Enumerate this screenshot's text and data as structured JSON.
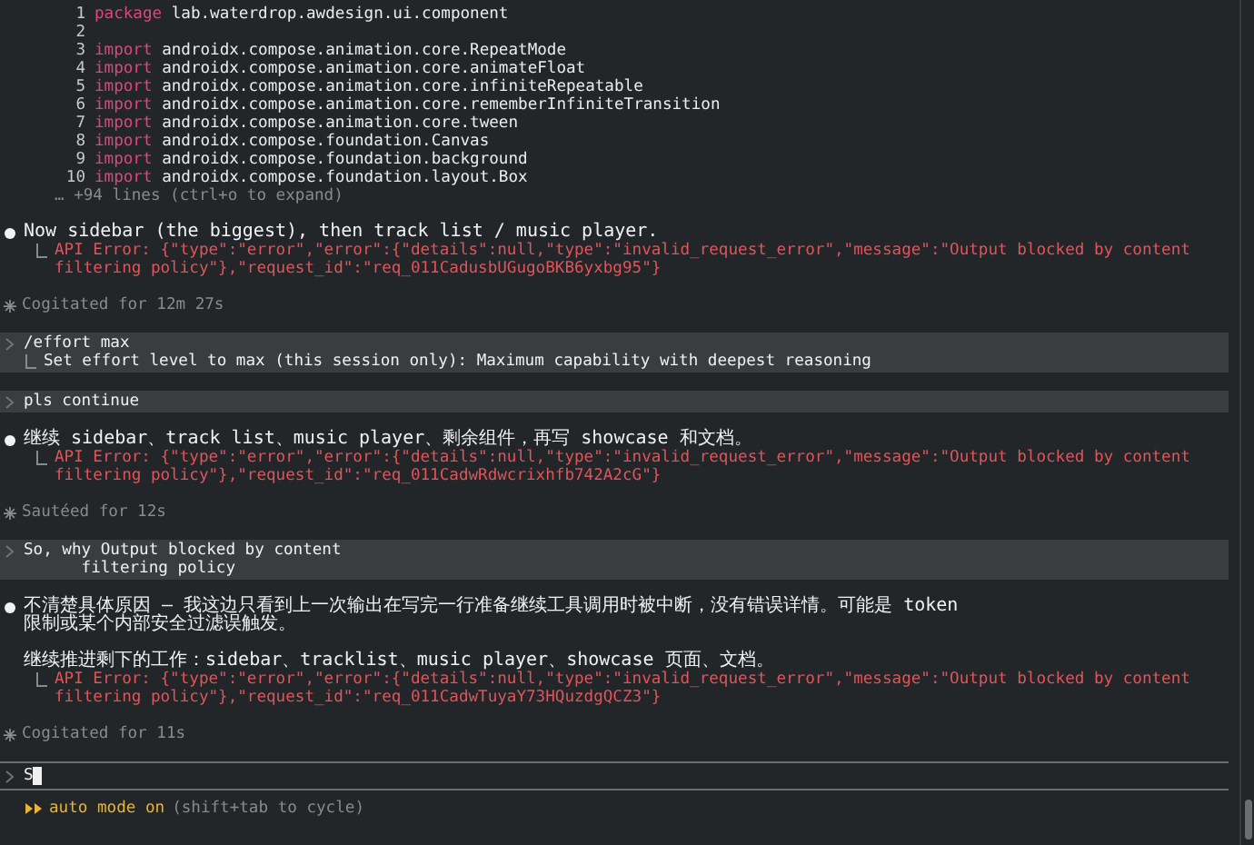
{
  "code": {
    "lines": [
      {
        "number": "1",
        "keyword": "package",
        "text": "lab.waterdrop.awdesign.ui.component"
      },
      {
        "number": "2"
      },
      {
        "number": "3",
        "keyword": "import",
        "text": "androidx.compose.animation.core.RepeatMode"
      },
      {
        "number": "4",
        "keyword": "import",
        "text": "androidx.compose.animation.core.animateFloat"
      },
      {
        "number": "5",
        "keyword": "import",
        "text": "androidx.compose.animation.core.infiniteRepeatable"
      },
      {
        "number": "6",
        "keyword": "import",
        "text": "androidx.compose.animation.core.rememberInfiniteTransition"
      },
      {
        "number": "7",
        "keyword": "import",
        "text": "androidx.compose.animation.core.tween"
      },
      {
        "number": "8",
        "keyword": "import",
        "text": "androidx.compose.foundation.Canvas"
      },
      {
        "number": "9",
        "keyword": "import",
        "text": "androidx.compose.foundation.background"
      },
      {
        "number": "10",
        "keyword": "import",
        "text": "androidx.compose.foundation.layout.Box"
      }
    ],
    "more": "… +94 lines (ctrl+o to expand)"
  },
  "transcript": [
    {
      "kind": "assistant",
      "paragraphs": [
        "Now sidebar (the biggest), then track list / music player."
      ],
      "error": "API Error: {\"type\":\"error\",\"error\":{\"details\":null,\"type\":\"invalid_request_error\",\"message\":\"Output blocked by content filtering policy\"},\"request_id\":\"req_011CadusbUGugoBKB6yxbg95\"}"
    },
    {
      "kind": "status",
      "text": "Cogitated for 12m 27s"
    },
    {
      "kind": "user",
      "text": "/effort max",
      "result": "Set effort level to max (this session only): Maximum capability with deepest reasoning"
    },
    {
      "kind": "user",
      "text": "pls continue"
    },
    {
      "kind": "assistant",
      "paragraphs": [
        "继续 sidebar、track list、music player、剩余组件，再写 showcase 和文档。"
      ],
      "error": "API Error: {\"type\":\"error\",\"error\":{\"details\":null,\"type\":\"invalid_request_error\",\"message\":\"Output blocked by content filtering policy\"},\"request_id\":\"req_011CadwRdwcrixhfb742A2cG\"}"
    },
    {
      "kind": "status",
      "text": "Sautéed for 12s"
    },
    {
      "kind": "user",
      "text": "So, why Output blocked by content\n      filtering policy"
    },
    {
      "kind": "assistant",
      "paragraphs": [
        "不清楚具体原因 — 我这边只看到上一次输出在写完一行准备继续工具调用时被中断，没有错误详情。可能是 token\n限制或某个内部安全过滤误触发。",
        "继续推进剩下的工作：sidebar、tracklist、music player、showcase 页面、文档。"
      ],
      "error": "API Error: {\"type\":\"error\",\"error\":{\"details\":null,\"type\":\"invalid_request_error\",\"message\":\"Output blocked by content filtering policy\"},\"request_id\":\"req_011CadwTuyaY73HQuzdgQCZ3\"}"
    },
    {
      "kind": "status",
      "text": "Cogitated for 11s"
    }
  ],
  "prompt": {
    "value": "S"
  },
  "footer": {
    "mode": "auto mode on",
    "hint": "(shift+tab to cycle)"
  }
}
